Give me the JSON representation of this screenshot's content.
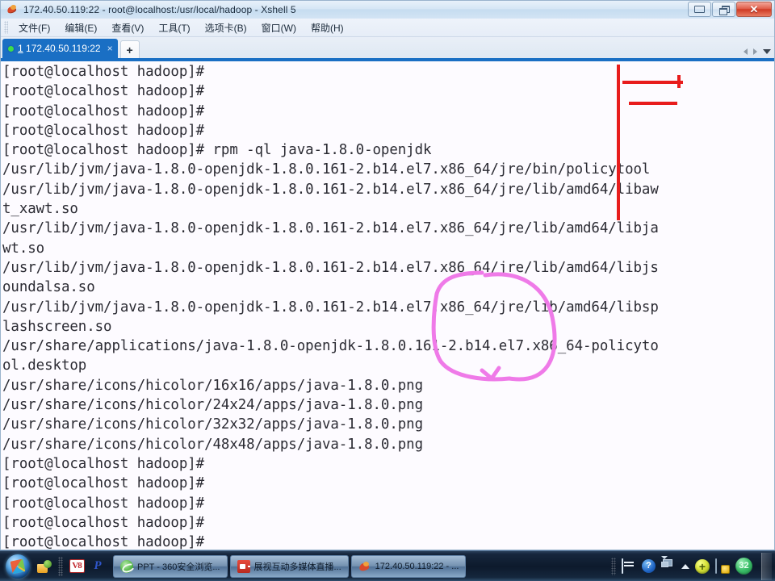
{
  "window": {
    "title": "172.40.50.119:22 - root@localhost:/usr/local/hadoop - Xshell 5",
    "icon": "xshell-icon",
    "buttons": {
      "minimize": "minimize-button",
      "restore": "restore-button",
      "close": "✕"
    }
  },
  "menubar": {
    "items": [
      {
        "label": "文件(F)"
      },
      {
        "label": "编辑(E)"
      },
      {
        "label": "查看(V)"
      },
      {
        "label": "工具(T)"
      },
      {
        "label": "选项卡(B)"
      },
      {
        "label": "窗口(W)"
      },
      {
        "label": "帮助(H)"
      }
    ]
  },
  "tabbar": {
    "tabs": [
      {
        "index": "1",
        "label": "172.40.50.119:22",
        "close": "×",
        "status": "connected"
      }
    ],
    "new_tab_label": "+",
    "scroll_left": "◀",
    "scroll_right": "▶",
    "tab_list": "▼"
  },
  "terminal": {
    "colors": {
      "background": "#fdfbff",
      "foreground": "#2b2b33",
      "annotation_red": "#e81c1c",
      "annotation_pink": "#ef7ae8"
    },
    "lines": [
      "[root@localhost hadoop]#",
      "[root@localhost hadoop]#",
      "[root@localhost hadoop]#",
      "[root@localhost hadoop]#",
      "[root@localhost hadoop]# rpm -ql java-1.8.0-openjdk",
      "/usr/lib/jvm/java-1.8.0-openjdk-1.8.0.161-2.b14.el7.x86_64/jre/bin/policytool",
      "/usr/lib/jvm/java-1.8.0-openjdk-1.8.0.161-2.b14.el7.x86_64/jre/lib/amd64/libaw",
      "t_xawt.so",
      "/usr/lib/jvm/java-1.8.0-openjdk-1.8.0.161-2.b14.el7.x86_64/jre/lib/amd64/libja",
      "wt.so",
      "/usr/lib/jvm/java-1.8.0-openjdk-1.8.0.161-2.b14.el7.x86_64/jre/lib/amd64/libjs",
      "oundalsa.so",
      "/usr/lib/jvm/java-1.8.0-openjdk-1.8.0.161-2.b14.el7.x86_64/jre/lib/amd64/libsp",
      "lashscreen.so",
      "/usr/share/applications/java-1.8.0-openjdk-1.8.0.161-2.b14.el7.x86_64-policyto",
      "ol.desktop",
      "/usr/share/icons/hicolor/16x16/apps/java-1.8.0.png",
      "/usr/share/icons/hicolor/24x24/apps/java-1.8.0.png",
      "/usr/share/icons/hicolor/32x32/apps/java-1.8.0.png",
      "/usr/share/icons/hicolor/48x48/apps/java-1.8.0.png",
      "[root@localhost hadoop]#",
      "[root@localhost hadoop]#",
      "[root@localhost hadoop]#",
      "[root@localhost hadoop]#",
      "[root@localhost hadoop]#"
    ],
    "annotations": [
      {
        "name": "red-vertical-line",
        "color": "#e81c1c"
      },
      {
        "name": "red-underline-bin",
        "color": "#e81c1c"
      },
      {
        "name": "red-underline-lib",
        "color": "#e81c1c"
      },
      {
        "name": "pink-circle-png",
        "color": "#ef7ae8"
      }
    ]
  },
  "taskbar": {
    "start_button": "start-orb",
    "quick_launch": [
      {
        "name": "explorer-icon"
      },
      {
        "name": "vegas-icon",
        "label": "V8"
      },
      {
        "name": "powerpoint-icon",
        "label": "P"
      }
    ],
    "windows": [
      {
        "label": "PPT - 360安全浏览...",
        "icon": "browser-icon"
      },
      {
        "label": "展视互动多媒体直播...",
        "icon": "live-stream-icon"
      },
      {
        "label": "172.40.50.119:22 - ...",
        "icon": "xshell-icon"
      }
    ],
    "tray": [
      {
        "name": "keyboard-icon"
      },
      {
        "name": "help-icon",
        "label": "?"
      },
      {
        "name": "monitor-icon"
      },
      {
        "name": "show-hidden-icons-icon"
      },
      {
        "name": "update-icon",
        "label": "+"
      },
      {
        "name": "security-icon"
      },
      {
        "name": "counter-badge",
        "label": "32"
      }
    ]
  }
}
